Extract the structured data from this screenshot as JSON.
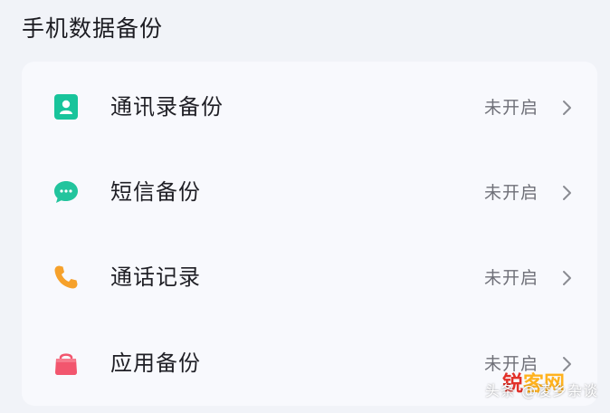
{
  "section": {
    "title": "手机数据备份"
  },
  "rows": [
    {
      "label": "通讯录备份",
      "status": "未开启",
      "icon": "contacts-icon",
      "icon_color": "#18c49b"
    },
    {
      "label": "短信备份",
      "status": "未开启",
      "icon": "message-icon",
      "icon_color": "#22c49d"
    },
    {
      "label": "通话记录",
      "status": "未开启",
      "icon": "phone-icon",
      "icon_color": "#f6a12b"
    },
    {
      "label": "应用备份",
      "status": "未开启",
      "icon": "app-bag-icon",
      "icon_color": "#f2566e"
    }
  ],
  "watermark": {
    "logo_a": "锐",
    "logo_b": "客网",
    "text": "头条 @凌乡杂谈"
  },
  "colors": {
    "background": "#f1f3f8",
    "card": "#f8f9fd",
    "text": "#1f1f25",
    "status": "#6f7078"
  }
}
